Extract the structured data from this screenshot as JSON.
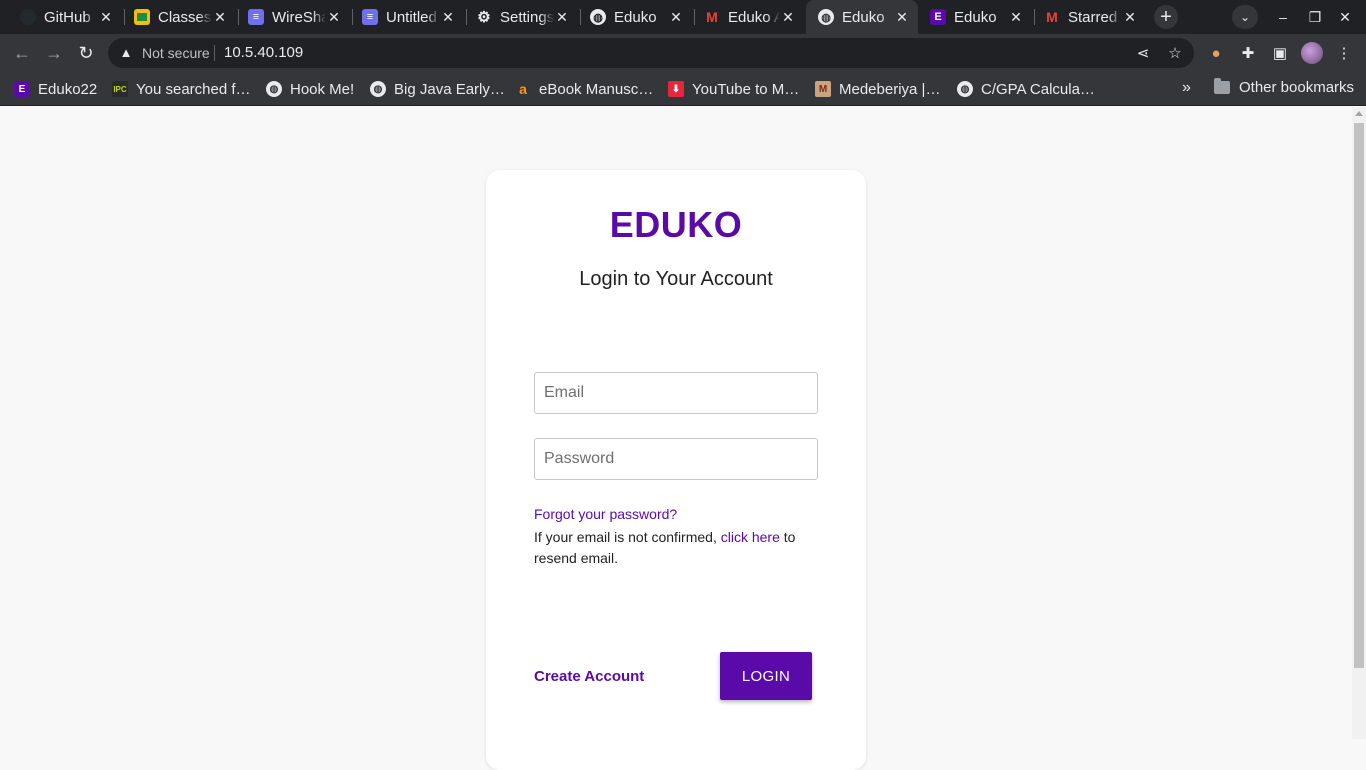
{
  "browser": {
    "tabs": [
      {
        "title": "GitHub",
        "icon": "github-icon"
      },
      {
        "title": "Classes",
        "icon": "classroom-icon"
      },
      {
        "title": "WireShark",
        "icon": "docs-icon"
      },
      {
        "title": "Untitled",
        "icon": "docs-icon"
      },
      {
        "title": "Settings",
        "icon": "gear-icon"
      },
      {
        "title": "Eduko",
        "icon": "globe-icon"
      },
      {
        "title": "Eduko App",
        "icon": "gmail-icon"
      },
      {
        "title": "Eduko",
        "icon": "globe-icon",
        "active": true
      },
      {
        "title": "Eduko",
        "icon": "eduko-icon"
      },
      {
        "title": "Starred",
        "icon": "gmail-icon"
      }
    ],
    "omnibox": {
      "security_label": "Not secure",
      "url": "10.5.40.109"
    },
    "bookmarks": [
      {
        "label": "Eduko22",
        "icon": "eduko-icon"
      },
      {
        "label": "You searched f…",
        "icon": "ipc-icon"
      },
      {
        "label": "Hook Me!",
        "icon": "globe-icon"
      },
      {
        "label": "Big Java Early…",
        "icon": "globe-icon"
      },
      {
        "label": "eBook Manusc…",
        "icon": "amazon-icon"
      },
      {
        "label": "YouTube to M…",
        "icon": "download-icon"
      },
      {
        "label": "Medeberiya |…",
        "icon": "medeberiya-icon"
      },
      {
        "label": "C/GPA Calcula…",
        "icon": "globe-icon"
      }
    ],
    "other_bookmarks": "Other bookmarks",
    "colors": {
      "tab_strip": "#202124",
      "toolbar": "#35363a"
    }
  },
  "page": {
    "brand": "EDUKO",
    "subtitle": "Login to Your Account",
    "email_placeholder": "Email",
    "password_placeholder": "Password",
    "forgot_link": "Forgot your password?",
    "confirm_text_before": "If your email is not confirmed, ",
    "confirm_link": "click here",
    "confirm_text_after": " to resend email.",
    "create_account": "Create Account",
    "login_button": "LOGIN",
    "colors": {
      "accent": "#5a0aa8",
      "background": "#f8f8f8",
      "card": "#ffffff"
    }
  }
}
